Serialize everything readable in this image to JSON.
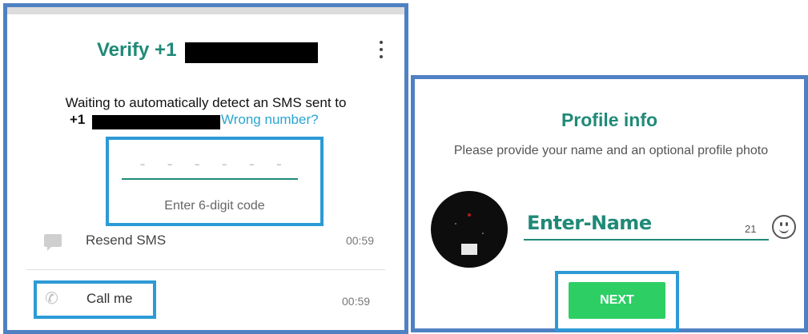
{
  "verify": {
    "title": "Verify +1",
    "waiting_text": "Waiting to automatically detect an SMS sent to",
    "phone_prefix": "+1",
    "wrong_number_link": "Wrong number?",
    "code_placeholder": "- - -   - - -",
    "code_hint": "Enter 6-digit code",
    "resend_label": "Resend SMS",
    "resend_timer": "00:59",
    "call_label": "Call me",
    "call_timer": "00:59",
    "menu_icon": "overflow-menu-icon",
    "resend_icon": "message-icon",
    "call_icon": "phone-icon"
  },
  "profile": {
    "title": "Profile info",
    "subtitle": "Please provide your name and an optional profile photo",
    "name_value": "Enter-Name",
    "char_count": "21",
    "emoji_icon": "emoji-icon",
    "next_label": "NEXT"
  },
  "colors": {
    "accent": "#1f8a77",
    "link": "#2aa5cf",
    "highlight_border": "#2d9ad6",
    "panel_border": "#4f81c2",
    "next_button": "#2dcf65"
  }
}
